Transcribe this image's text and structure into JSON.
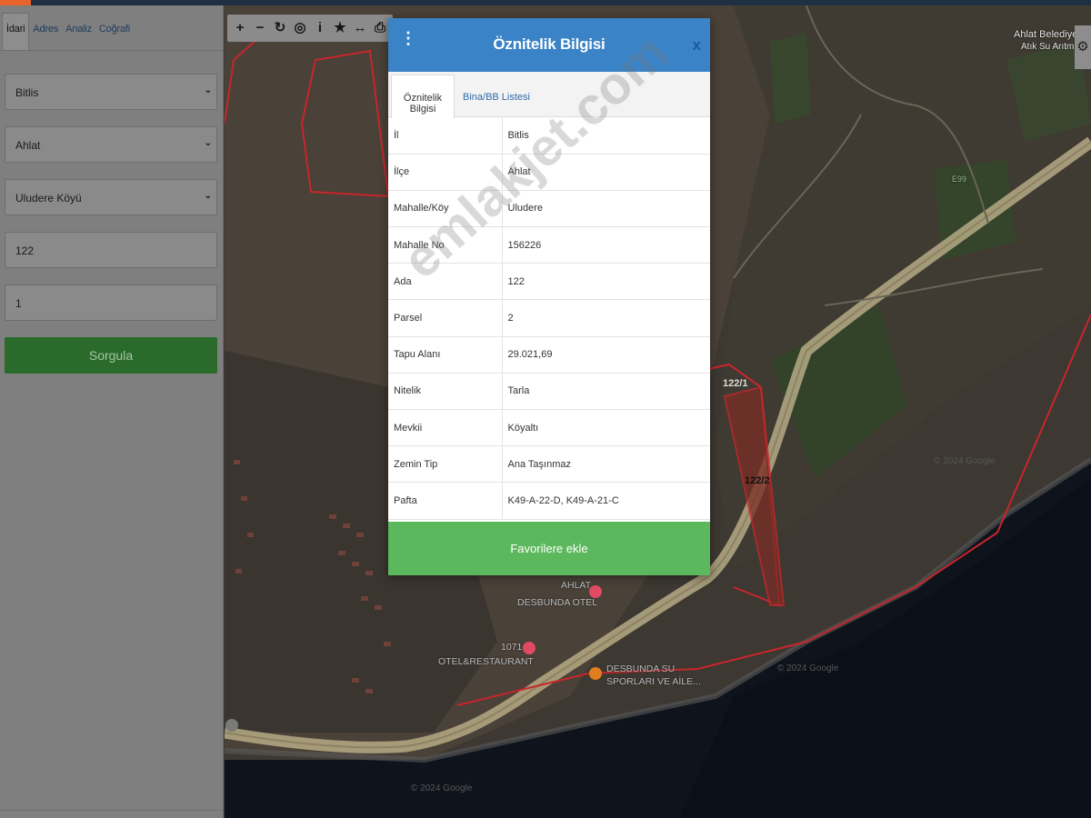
{
  "sidebar": {
    "tabs": [
      {
        "label": "İdari",
        "active": true
      },
      {
        "label": "Adres",
        "active": false
      },
      {
        "label": "Analiz",
        "active": false
      },
      {
        "label": "Coğrafi",
        "active": false
      }
    ],
    "il_select": "Bitlis",
    "ilce_select": "Ahlat",
    "mahalle_select": "Uludere Köyü",
    "ada_input": "122",
    "parsel_input": "1",
    "query_button": "Sorgula"
  },
  "map": {
    "toolbar_icons": [
      "plus-icon",
      "minus-icon",
      "refresh-icon",
      "locate-icon",
      "info-icon",
      "star-icon",
      "measure-icon",
      "print-icon"
    ],
    "labels": {
      "ahlat_belediyesi": "Ahlat Belediyes",
      "atik_su": "Atık Su Arıtm",
      "road": "E99",
      "parcel_1": "122/1",
      "parcel_2": "122/2",
      "poi_otel_1": "AHLAT",
      "poi_otel_2": "DESBUNDA OTEL",
      "poi_restaurant_1": "1071",
      "poi_restaurant_2": "OTEL&RESTAURANT",
      "poi_su_1": "DESBUNDA SU",
      "poi_su_2": "SPORLARI VE AİLE...",
      "google_1": "© 2024 Google",
      "google_2": "© 2024 Google",
      "google_3": "© 2024 Google"
    }
  },
  "modal": {
    "title": "Öznitelik Bilgisi",
    "close": "x",
    "tabs": [
      {
        "label": "Öznitelik Bilgisi",
        "active": true
      },
      {
        "label": "Bina/BB Listesi",
        "active": false
      }
    ],
    "rows": [
      {
        "key": "İl",
        "value": "Bitlis"
      },
      {
        "key": "İlçe",
        "value": "Ahlat"
      },
      {
        "key": "Mahalle/Köy",
        "value": "Uludere"
      },
      {
        "key": "Mahalle No",
        "value": "156226"
      },
      {
        "key": "Ada",
        "value": "122"
      },
      {
        "key": "Parsel",
        "value": "2"
      },
      {
        "key": "Tapu Alanı",
        "value": "29.021,69"
      },
      {
        "key": "Nitelik",
        "value": "Tarla"
      },
      {
        "key": "Mevkii",
        "value": "Köyaltı"
      },
      {
        "key": "Zemin Tip",
        "value": "Ana Taşınmaz"
      },
      {
        "key": "Pafta",
        "value": "K49-A-22-D, K49-A-21-C"
      }
    ],
    "favorite_button": "Favorilere ekle"
  },
  "watermark": "emlakjet.com",
  "colors": {
    "header_blue": "#3a83c7",
    "button_green": "#5cb85c",
    "query_green": "#2a6a2a",
    "parcel_red": "#c8262b"
  }
}
